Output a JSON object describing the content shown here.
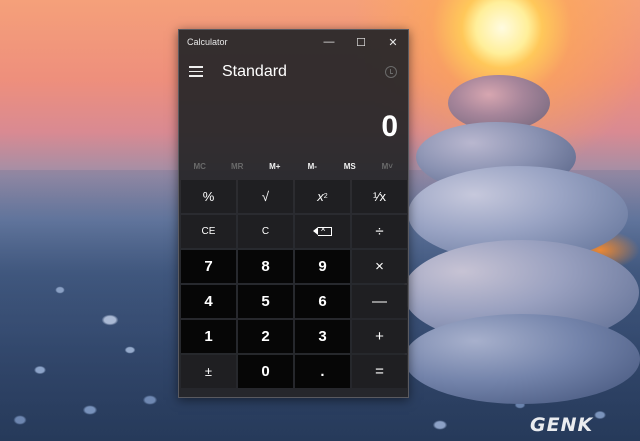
{
  "window": {
    "title": "Calculator",
    "minimize_glyph": "—",
    "maximize_glyph": "☐",
    "close_glyph": "✕"
  },
  "header": {
    "menu_icon": "hamburger-icon",
    "mode": "Standard",
    "history_icon": "history-icon"
  },
  "display": {
    "value": "0"
  },
  "memory": [
    {
      "label": "MC",
      "enabled": false
    },
    {
      "label": "MR",
      "enabled": false
    },
    {
      "label": "M+",
      "enabled": true
    },
    {
      "label": "M-",
      "enabled": true
    },
    {
      "label": "MS",
      "enabled": true
    },
    {
      "label": "M˅",
      "enabled": false
    }
  ],
  "keys": {
    "percent": "%",
    "sqrt": "√",
    "square_base": "x",
    "square_exp": "2",
    "reciprocal": "¹⁄x",
    "ce": "CE",
    "c": "C",
    "backspace_icon": "backspace-icon",
    "divide": "÷",
    "seven": "7",
    "eight": "8",
    "nine": "9",
    "multiply": "×",
    "four": "4",
    "five": "5",
    "six": "6",
    "minus": "—",
    "one": "1",
    "two": "2",
    "three": "3",
    "plus": "+",
    "negate": "±",
    "zero": "0",
    "decimal": ".",
    "equals": "="
  },
  "watermark": "GENK"
}
